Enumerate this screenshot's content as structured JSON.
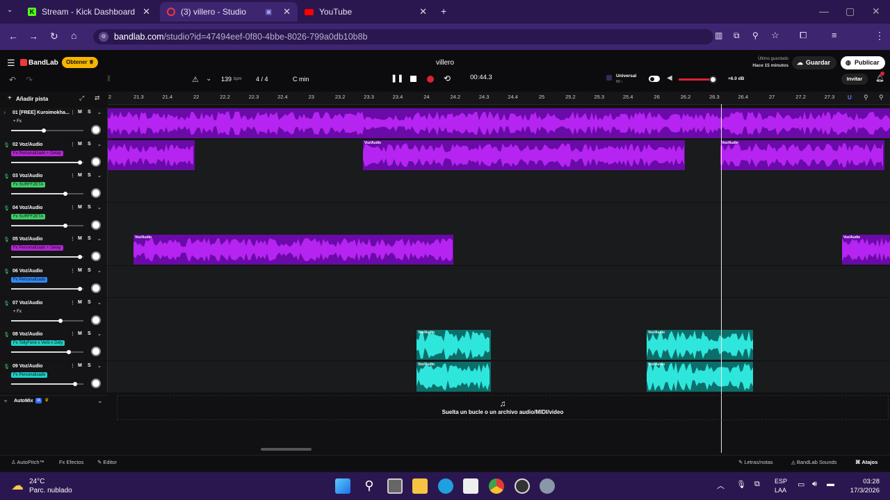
{
  "browser": {
    "tabs": [
      {
        "title": "Stream - Kick Dashboard",
        "favicon": "kick-icon"
      },
      {
        "title": "(3) villero - Studio",
        "favicon": "bandlab-icon"
      },
      {
        "title": "YouTube",
        "favicon": "youtube-icon"
      }
    ],
    "url_host": "bandlab.com",
    "url_path": "/studio?id=47494eef-0f80-4bbe-8026-799a0db10b8b"
  },
  "app": {
    "logo": "BandLab",
    "obtener": "Obtener ♕",
    "project_title": "villero",
    "last_saved_label": "Último guardado",
    "last_saved_value": "Hace 15 minutos",
    "guardar": "Guardar",
    "publicar": "Publicar",
    "invitar": "Invitar",
    "bpm": "139",
    "bpm_unit": "bpm",
    "time_sig": "4 / 4",
    "key": "C min",
    "time": "00:44.3",
    "preset": "Universal",
    "preset_sub": "50 ›",
    "master_db": "+6.0 dB",
    "master_level": 0.95,
    "add_track": "Añadir pista",
    "drop_text": "Suelta un bucle o un archivo audio/MIDI/video",
    "automix": "AutoMix",
    "automix_badge": "IA"
  },
  "ruler_ticks": [
    "2",
    "21.3",
    "21.4",
    "22",
    "22.2",
    "22.3",
    "22.4",
    "23",
    "23.2",
    "23.3",
    "23.4",
    "24",
    "24.2",
    "24.3",
    "24.4",
    "25",
    "25.2",
    "25.3",
    "25.4",
    "26",
    "26.2",
    "26.3",
    "26.4",
    "27",
    "27.2",
    "27.3"
  ],
  "tracks": [
    {
      "num": "01",
      "name": "[FREE] Kuroimokha...",
      "fx": "+ Fx",
      "fx_color": "",
      "volume": 0.45
    },
    {
      "num": "02",
      "name": "Voz/Audio",
      "fx": "Fx Personalizado + Delay",
      "fx_color": "#b326d6",
      "volume": 0.95
    },
    {
      "num": "03",
      "name": "Voz/Audio",
      "fx": "Fx SURFFZETA",
      "fx_color": "#3ccf6a",
      "volume": 0.75
    },
    {
      "num": "04",
      "name": "Voz/Audio",
      "fx": "Fx SURFFZETA",
      "fx_color": "#3ccf6a",
      "volume": 0.75
    },
    {
      "num": "05",
      "name": "Voz/Audio",
      "fx": "Fx Personalizado + Delay",
      "fx_color": "#b326d6",
      "volume": 0.95
    },
    {
      "num": "06",
      "name": "Voz/Audio",
      "fx": "Fx Personalizado",
      "fx_color": "#2f8cff",
      "volume": 0.95
    },
    {
      "num": "07",
      "name": "Voz/Audio",
      "fx": "+ Fx",
      "fx_color": "",
      "volume": 0.68
    },
    {
      "num": "08",
      "name": "Voz/Audio",
      "fx": "Fx TollyFone x Verb n Dely",
      "fx_color": "#1fd0c8",
      "volume": 0.8
    },
    {
      "num": "09",
      "name": "Voz/Audio",
      "fx": "Fx Personalizado",
      "fx_color": "#1fd0c8",
      "volume": 0.88
    }
  ],
  "clip_label": "Voz/Audio",
  "bottom": {
    "autopitch": "AutoPitch™",
    "efectos": "Efectos",
    "editor": "Editor",
    "letras": "Letras/notas",
    "sounds": "BandLab Sounds",
    "atajos": "Atajos"
  },
  "taskbar": {
    "temp": "24°C",
    "weather": "Parc. nublado",
    "lang1": "ESP",
    "lang2": "LAA",
    "time": "03:28",
    "date": "17/3/2026"
  }
}
